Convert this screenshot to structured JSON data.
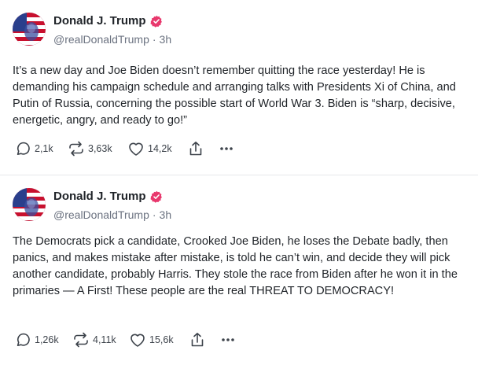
{
  "posts": [
    {
      "author_name": "Donald J. Trump",
      "handle": "@realDonaldTrump",
      "separator": "·",
      "time": "3h",
      "text": "It’s a new day and Joe Biden doesn’t remember quitting the race yesterday! He is demanding his campaign schedule and arranging talks with Presidents Xi of China, and Putin of Russia, concerning the possible start of World War 3. Biden is “sharp, decisive, energetic, angry, and ready to go!”",
      "replies": "2,1k",
      "reposts": "3,63k",
      "likes": "14,2k"
    },
    {
      "author_name": "Donald J. Trump",
      "handle": "@realDonaldTrump",
      "separator": "·",
      "time": "3h",
      "text": "The Democrats pick a candidate, Crooked Joe Biden, he loses the Debate badly, then panics, and makes mistake after mistake, is told he can’t win, and decide they will pick another candidate, probably Harris. They stole the race from Biden after he won it in the primaries — A First! These people are the real THREAT TO DEMOCRACY!",
      "replies": "1,26k",
      "reposts": "4,11k",
      "likes": "15,6k"
    }
  ],
  "colors": {
    "verified_badge": "#e8386d",
    "text": "#1f2328",
    "muted": "#6b7280",
    "divider": "#e6e8eb"
  },
  "icons": [
    "flag-avatar",
    "verified-badge-icon",
    "reply-icon",
    "repost-icon",
    "like-icon",
    "share-icon",
    "more-icon"
  ]
}
